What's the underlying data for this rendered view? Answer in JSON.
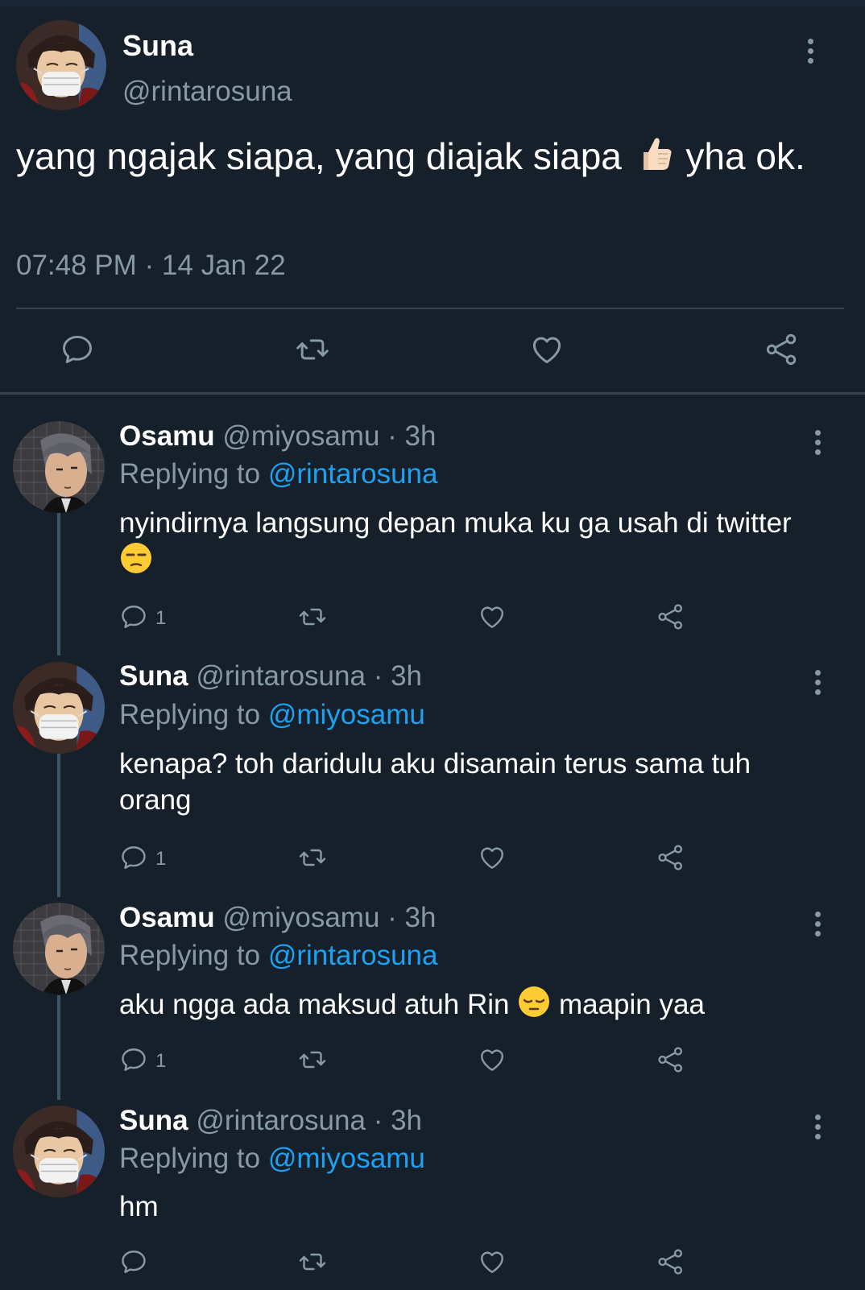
{
  "main_tweet": {
    "name": "Suna",
    "handle": "@rintarosuna",
    "text_before": "yang ngajak siapa, yang diajak siapa",
    "emoji": "thumbs-up",
    "text_after": "yha ok.",
    "timestamp": "07:48 PM · 14 Jan 22"
  },
  "replies": [
    {
      "name": "Osamu",
      "handle": "@miyosamu",
      "time": "· 3h",
      "replying_label": "Replying to",
      "replying_to": "@rintarosuna",
      "text": "nyindirnya langsung depan muka ku ga usah di twitter",
      "emoji": "unamused-face",
      "reply_count": "1"
    },
    {
      "name": "Suna",
      "handle": "@rintarosuna",
      "time": "· 3h",
      "replying_label": "Replying to",
      "replying_to": "@miyosamu",
      "text": "kenapa? toh daridulu aku disamain terus sama tuh orang",
      "reply_count": "1"
    },
    {
      "name": "Osamu",
      "handle": "@miyosamu",
      "time": "· 3h",
      "replying_label": "Replying to",
      "replying_to": "@rintarosuna",
      "text_before": "aku ngga ada maksud atuh Rin",
      "emoji": "pensive-face",
      "text_after": "maapin yaa",
      "reply_count": "1"
    },
    {
      "name": "Suna",
      "handle": "@rintarosuna",
      "time": "· 3h",
      "replying_label": "Replying to",
      "replying_to": "@miyosamu",
      "text": "hm",
      "reply_count": ""
    }
  ],
  "colors": {
    "background": "#15202b",
    "muted": "#8899a6",
    "link": "#1da1f2",
    "divider": "#38444d"
  }
}
